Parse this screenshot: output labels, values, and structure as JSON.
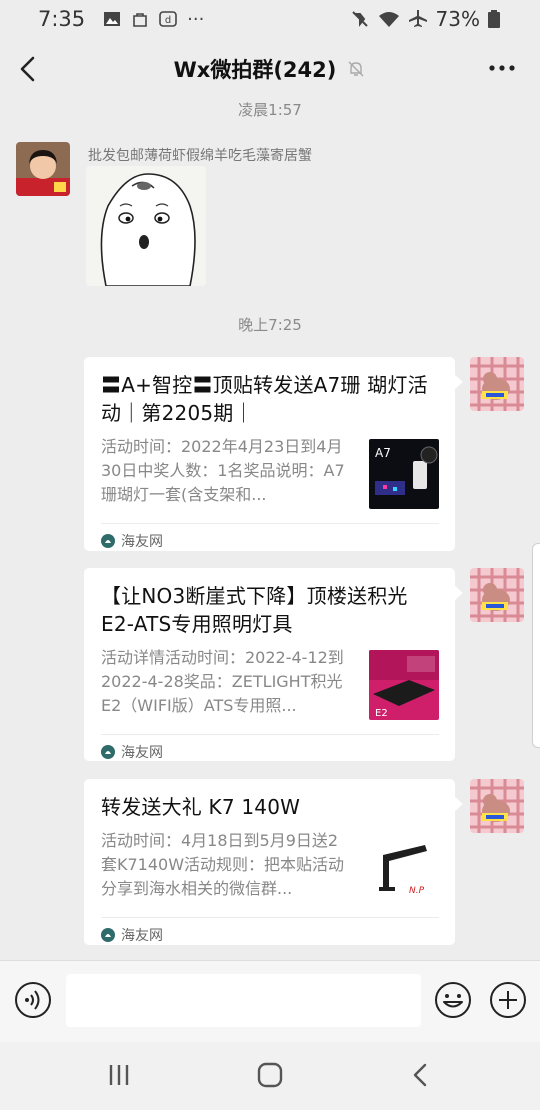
{
  "status": {
    "time": "7:35",
    "battery": "73%"
  },
  "header": {
    "title": "Wx微拍群(242)"
  },
  "messages": {
    "ts1": "凌晨1:57",
    "sender1": "批发包邮薄荷虾假绵羊吃毛藻寄居蟹",
    "ts2": "晚上7:25"
  },
  "cards": [
    {
      "title": "〓A+智控〓顶贴转发送A7珊 瑚灯活动｜第2205期｜",
      "desc": "活动时间：2022年4月23日到4月30日中奖人数：1名奖品说明：A7珊瑚灯一套(含支架和...",
      "source": "海友网",
      "thumb_text": "A7"
    },
    {
      "title": "【让NO3断崖式下降】顶楼送积光E2-ATS专用照明灯具",
      "desc": "活动详情活动时间：2022-4-12到2022-4-28奖品：ZETLIGHT积光E2（WIFI版）ATS专用照...",
      "source": "海友网",
      "thumb_text": "E2"
    },
    {
      "title": "转发送大礼 K7 140W",
      "desc": "活动时间：4月18日到5月9日送2套K7140W活动规则：把本贴活动分享到海水相关的微信群...",
      "source": "海友网",
      "thumb_text": "N.P"
    }
  ],
  "input": {
    "placeholder": ""
  },
  "icons": {
    "back": "back-arrow-icon",
    "mute": "mute-bell-icon",
    "more": "more-dots-icon",
    "voice": "voice-icon",
    "emoji": "emoji-icon",
    "plus": "plus-icon"
  }
}
